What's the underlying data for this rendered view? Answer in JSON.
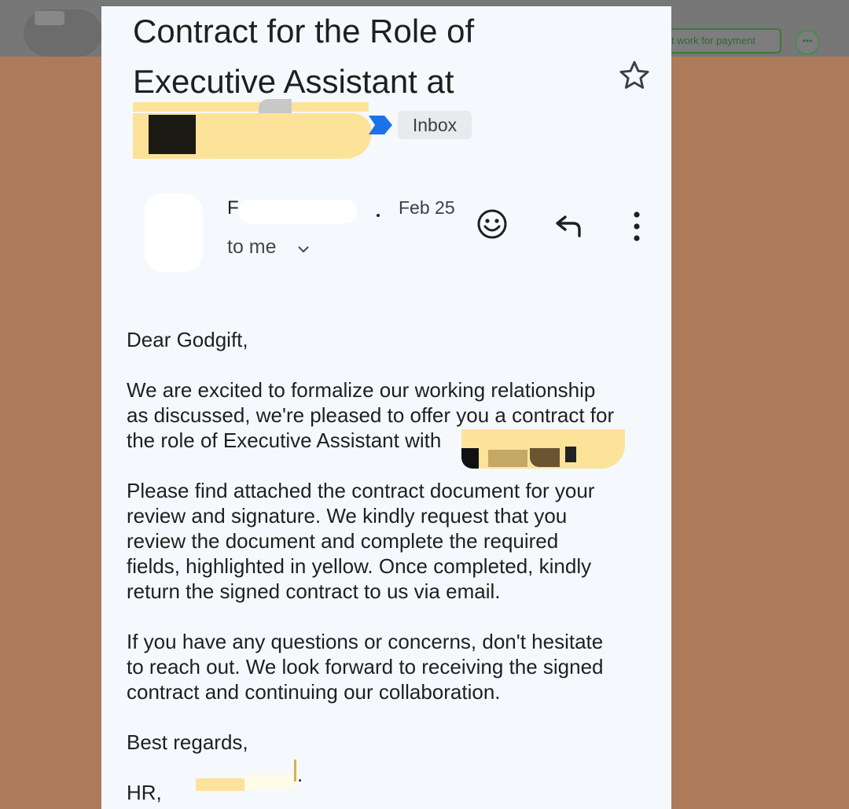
{
  "background": {
    "chip_label": "t work for payment",
    "more_label": "•••"
  },
  "email": {
    "subject": "Contract for the Role of Executive Assistant at",
    "label": "Inbox",
    "sender_visible": "F",
    "date": "Feb 25",
    "recipient": "to me",
    "greeting": "Dear Godgift,",
    "paragraphs": [
      "We are excited to formalize our working relationship\nas discussed, we're pleased to offer you a contract for\nthe role of Executive Assistant with",
      "Please find attached the contract document for your\nreview and signature. We kindly request that you\nreview the document and complete the required\nfields, highlighted in yellow. Once completed, kindly\nreturn the signed contract to us via email.",
      "If you have any questions or concerns, don't hesitate\nto reach out. We look forward to receiving the signed\ncontract and continuing our collaboration."
    ],
    "closing": "Best regards,",
    "signature": "HR,",
    "signature_end": "."
  },
  "icons": {
    "star": "star-outline-icon",
    "label_arrow": "important-marker-icon",
    "emoji": "add-reaction-icon",
    "reply": "reply-icon",
    "more": "more-vertical-icon",
    "chevron": "chevron-down-icon"
  },
  "colors": {
    "page_bg": "#ad7a5a",
    "email_bg": "#f5f9fe",
    "important_marker": "#1a73e8",
    "redaction_yellow": "#fde39a"
  }
}
